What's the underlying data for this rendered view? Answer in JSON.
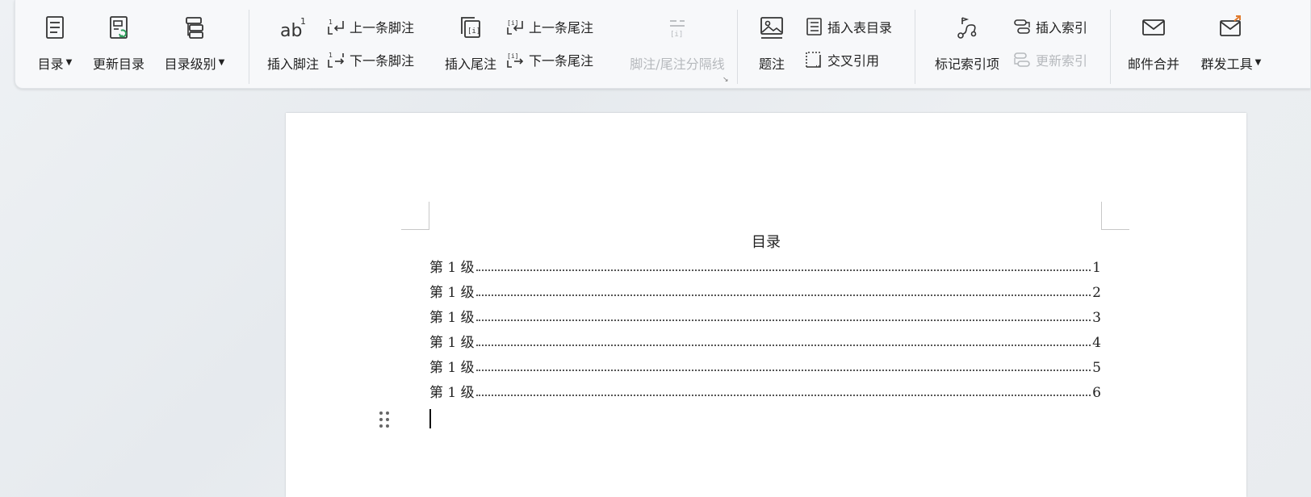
{
  "ribbon": {
    "toc": "目录",
    "update_toc": "更新目录",
    "toc_level": "目录级别",
    "insert_footnote": "插入脚注",
    "prev_footnote": "上一条脚注",
    "next_footnote": "下一条脚注",
    "insert_endnote": "插入尾注",
    "prev_endnote": "上一条尾注",
    "next_endnote": "下一条尾注",
    "note_separator": "脚注/尾注分隔线",
    "caption": "题注",
    "insert_table_of_figures": "插入表目录",
    "cross_reference": "交叉引用",
    "mark_index_entry": "标记索引项",
    "insert_index": "插入索引",
    "update_index": "更新索引",
    "mail_merge": "邮件合并",
    "bulk_send_tools": "群发工具"
  },
  "document": {
    "toc_heading": "目录",
    "entries": [
      {
        "text": "第 1 级",
        "page": "1"
      },
      {
        "text": "第 1 级",
        "page": "2"
      },
      {
        "text": "第 1 级",
        "page": "3"
      },
      {
        "text": "第 1 级",
        "page": "4"
      },
      {
        "text": "第 1 级",
        "page": "5"
      },
      {
        "text": "第 1 级",
        "page": "6"
      }
    ]
  }
}
